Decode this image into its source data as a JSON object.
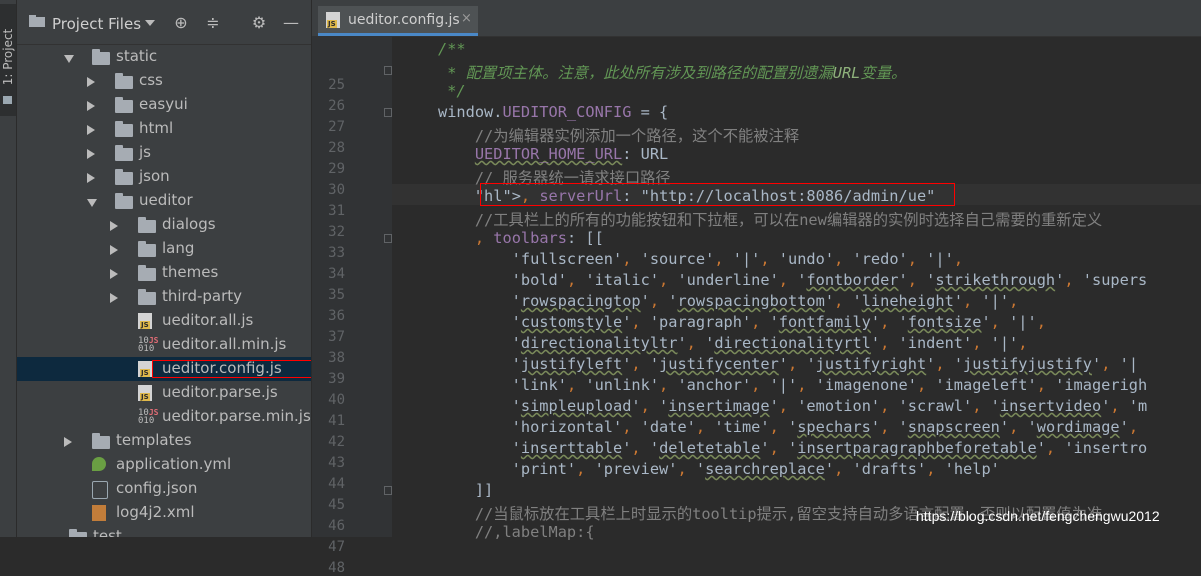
{
  "tool_window": {
    "label": "1: Project"
  },
  "project_panel": {
    "title": "Project Files",
    "tree": [
      {
        "label": "static",
        "kind": "folder",
        "indent": 1,
        "state": "open"
      },
      {
        "label": "css",
        "kind": "folder",
        "indent": 2,
        "state": "closed"
      },
      {
        "label": "easyui",
        "kind": "folder",
        "indent": 2,
        "state": "closed"
      },
      {
        "label": "html",
        "kind": "folder",
        "indent": 2,
        "state": "closed"
      },
      {
        "label": "js",
        "kind": "folder",
        "indent": 2,
        "state": "closed"
      },
      {
        "label": "json",
        "kind": "folder",
        "indent": 2,
        "state": "closed"
      },
      {
        "label": "ueditor",
        "kind": "folder",
        "indent": 2,
        "state": "open"
      },
      {
        "label": "dialogs",
        "kind": "folder",
        "indent": 3,
        "state": "closed"
      },
      {
        "label": "lang",
        "kind": "folder",
        "indent": 3,
        "state": "closed"
      },
      {
        "label": "themes",
        "kind": "folder",
        "indent": 3,
        "state": "closed"
      },
      {
        "label": "third-party",
        "kind": "folder",
        "indent": 3,
        "state": "closed"
      },
      {
        "label": "ueditor.all.js",
        "kind": "js",
        "indent": 3
      },
      {
        "label": "ueditor.all.min.js",
        "kind": "minjs",
        "indent": 3
      },
      {
        "label": "ueditor.config.js",
        "kind": "js",
        "indent": 3,
        "selected": true
      },
      {
        "label": "ueditor.parse.js",
        "kind": "js",
        "indent": 3
      },
      {
        "label": "ueditor.parse.min.js",
        "kind": "minjs",
        "indent": 3
      },
      {
        "label": "templates",
        "kind": "folder",
        "indent": 1,
        "state": "closed"
      },
      {
        "label": "application.yml",
        "kind": "yml",
        "indent": 1
      },
      {
        "label": "config.json",
        "kind": "json",
        "indent": 1
      },
      {
        "label": "log4j2.xml",
        "kind": "xml",
        "indent": 1
      },
      {
        "label": "test",
        "kind": "folder",
        "indent": 0
      }
    ]
  },
  "editor": {
    "tab": {
      "label": "ueditor.config.js",
      "close": "×"
    },
    "lines": [
      {
        "n": "25",
        "text": "/**",
        "cls": "doc"
      },
      {
        "n": "26",
        "text": " * 配置项主体。注意，此处所有涉及到路径的配置别遗漏URL变量。",
        "cls": "doc"
      },
      {
        "n": "27",
        "text": " */",
        "cls": "doc"
      },
      {
        "n": "28",
        "text": "window.UEDITOR_CONFIG = {",
        "cls": ""
      },
      {
        "n": "29",
        "text": "    //为编辑器实例添加一个路径，这个不能被注释",
        "cls": "cm"
      },
      {
        "n": "30",
        "text": "    UEDITOR_HOME_URL: URL",
        "cls": ""
      },
      {
        "n": "31",
        "text": "    // 服务器统一请求接口路径",
        "cls": "cm"
      },
      {
        "n": "32",
        "text": "    , serverUrl: \"http://localhost:8086/admin/ue\"",
        "cls": ""
      },
      {
        "n": "33",
        "text": "    //工具栏上的所有的功能按钮和下拉框，可以在new编辑器的实例时选择自己需要的重新定义",
        "cls": "cm"
      },
      {
        "n": "34",
        "text": "    , toolbars: [[",
        "cls": ""
      },
      {
        "n": "35",
        "text": "        'fullscreen', 'source', '|', 'undo', 'redo', '|',",
        "cls": "str"
      },
      {
        "n": "36",
        "text": "        'bold', 'italic', 'underline', 'fontborder', 'strikethrough', 'supers",
        "cls": "str"
      },
      {
        "n": "37",
        "text": "        'rowspacingtop', 'rowspacingbottom', 'lineheight', '|',",
        "cls": "str"
      },
      {
        "n": "38",
        "text": "        'customstyle', 'paragraph', 'fontfamily', 'fontsize', '|',",
        "cls": "str"
      },
      {
        "n": "39",
        "text": "        'directionalityltr', 'directionalityrtl', 'indent', '|',",
        "cls": "str"
      },
      {
        "n": "40",
        "text": "        'justifyleft', 'justifycenter', 'justifyright', 'justifyjustify', '|",
        "cls": "str"
      },
      {
        "n": "41",
        "text": "        'link', 'unlink', 'anchor', '|', 'imagenone', 'imageleft', 'imagerigh",
        "cls": "str"
      },
      {
        "n": "42",
        "text": "        'simpleupload', 'insertimage', 'emotion', 'scrawl', 'insertvideo', 'm",
        "cls": "str"
      },
      {
        "n": "43",
        "text": "        'horizontal', 'date', 'time', 'spechars', 'snapscreen', 'wordimage', ",
        "cls": "str"
      },
      {
        "n": "44",
        "text": "        'inserttable', 'deletetable', 'insertparagraphbeforetable', 'insertro",
        "cls": "str"
      },
      {
        "n": "45",
        "text": "        'print', 'preview', 'searchreplace', 'drafts', 'help'",
        "cls": "str"
      },
      {
        "n": "46",
        "text": "    ]]",
        "cls": ""
      },
      {
        "n": "47",
        "text": "    //当鼠标放在工具栏上时显示的tooltip提示,留空支持自动多语言配置，否则以配置值为准",
        "cls": "cm"
      },
      {
        "n": "48",
        "text": "    //,labelMap:{",
        "cls": "cm"
      }
    ]
  },
  "watermark": "https://blog.csdn.net/fengchengwu2012"
}
